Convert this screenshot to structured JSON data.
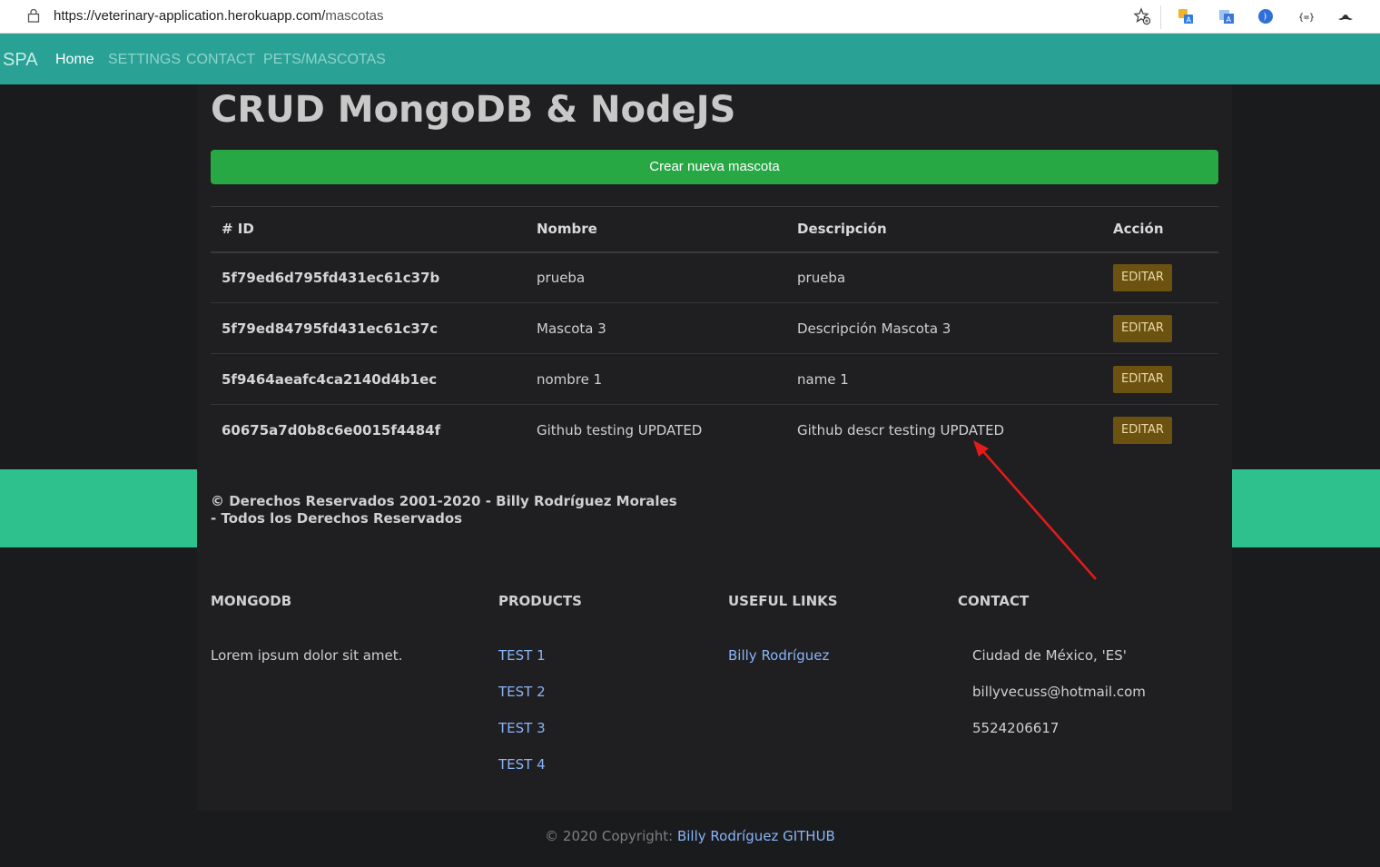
{
  "browser": {
    "url_host": "https://veterinary-application.herokuapp.com/",
    "url_path": "mascotas"
  },
  "navbar": {
    "brand": "SPA",
    "links": [
      "Home",
      "SETTINGS",
      "CONTACT",
      "PETS/MASCOTAS"
    ]
  },
  "main": {
    "title": "CRUD MongoDB & NodeJS",
    "create_button": "Crear nueva mascota",
    "table": {
      "headers": [
        "# ID",
        "Nombre",
        "Descripción",
        "Acción"
      ],
      "rows": [
        {
          "id": "5f79ed6d795fd431ec61c37b",
          "nombre": "prueba",
          "descripcion": "prueba",
          "action": "EDITAR"
        },
        {
          "id": "5f79ed84795fd431ec61c37c",
          "nombre": "Mascota 3",
          "descripcion": "Descripción Mascota 3",
          "action": "EDITAR"
        },
        {
          "id": "5f9464aeafc4ca2140d4b1ec",
          "nombre": "nombre 1",
          "descripcion": "name 1",
          "action": "EDITAR"
        },
        {
          "id": "60675a7d0b8c6e0015f4484f",
          "nombre": "Github testing UPDATED",
          "descripcion": "Github descr testing UPDATED",
          "action": "EDITAR"
        }
      ]
    }
  },
  "band": {
    "line1": "© Derechos Reservados 2001-2020 - Billy Rodríguez Morales",
    "line2": "- Todos los Derechos Reservados"
  },
  "footer": {
    "mongodb": {
      "title": "MONGODB",
      "text": "Lorem ipsum dolor sit amet."
    },
    "products": {
      "title": "PRODUCTS",
      "links": [
        "TEST 1",
        "TEST 2",
        "TEST 3",
        "TEST 4"
      ]
    },
    "useful": {
      "title": "USEFUL LINKS",
      "links": [
        "Billy Rodríguez"
      ]
    },
    "contact": {
      "title": "CONTACT",
      "items": [
        "Ciudad de México, 'ES'",
        "billyvecuss@hotmail.com",
        "5524206617"
      ]
    }
  },
  "copyright": {
    "text": "© 2020 Copyright: ",
    "link": "Billy Rodríguez GITHUB"
  },
  "colors": {
    "navbar": "#29a295",
    "band": "#2fc18d",
    "create_button": "#28a745",
    "edit_button": "#6b5210",
    "annotation_arrow": "#e31b1b"
  }
}
